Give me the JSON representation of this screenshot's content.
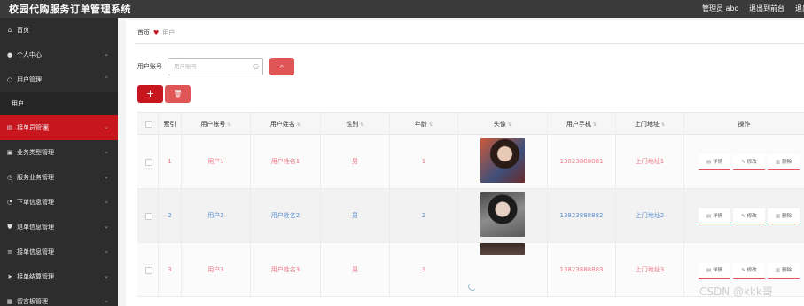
{
  "header": {
    "app_title": "校园代购服务订单管理系统",
    "user_label": "管理员 abo",
    "back_label": "退出到前台",
    "logout_label": "退出登录"
  },
  "sidebar": {
    "items": [
      {
        "label": "首页",
        "icon": "home-icon",
        "glyph": "⌂"
      },
      {
        "label": "个人中心",
        "icon": "person-icon",
        "glyph": "●"
      },
      {
        "label": "用户管理",
        "icon": "user-circle-icon",
        "glyph": "○"
      },
      {
        "label": "接单员管理",
        "icon": "document-icon",
        "glyph": "▤"
      },
      {
        "label": "业务类型管理",
        "icon": "clipboard-icon",
        "glyph": "▣"
      },
      {
        "label": "服务业务管理",
        "icon": "clock-icon",
        "glyph": "◷"
      },
      {
        "label": "下单信息管理",
        "icon": "circle-info-icon",
        "glyph": "◔"
      },
      {
        "label": "退单信息管理",
        "icon": "shield-icon",
        "glyph": "⛊"
      },
      {
        "label": "接单信息管理",
        "icon": "list-icon",
        "glyph": "≡"
      },
      {
        "label": "接单结算管理",
        "icon": "send-icon",
        "glyph": "➤"
      },
      {
        "label": "留言板管理",
        "icon": "grid-icon",
        "glyph": "▦"
      }
    ],
    "sub_item": "用户"
  },
  "breadcrumb": {
    "home": "首页",
    "current": "用户"
  },
  "search": {
    "label": "用户账号",
    "placeholder": "用户账号",
    "button_icon": "search-icon"
  },
  "actions": {
    "add_symbol": "+",
    "delete_symbol": "🗑"
  },
  "table": {
    "headers": [
      "索引",
      "用户账号",
      "用户姓名",
      "性别",
      "年龄",
      "头像",
      "用户手机",
      "上门地址",
      "操作"
    ],
    "rows": [
      {
        "index": "1",
        "account": "用户1",
        "name": "用户姓名1",
        "gender": "男",
        "age": "1",
        "phone": "13823888881",
        "address": "上门地址1",
        "color": "pink"
      },
      {
        "index": "2",
        "account": "用户2",
        "name": "用户姓名2",
        "gender": "男",
        "age": "2",
        "phone": "13823888882",
        "address": "上门地址2",
        "color": "blue"
      },
      {
        "index": "3",
        "account": "用户3",
        "name": "用户姓名3",
        "gender": "男",
        "age": "3",
        "phone": "13823888883",
        "address": "上门地址3",
        "color": "pink"
      }
    ],
    "op_labels": {
      "detail": "详情",
      "edit": "修改",
      "delete": "删除"
    }
  },
  "watermark": "CSDN @kkk哥",
  "colors": {
    "accent": "#c8161e",
    "accent_light": "#e05555",
    "sidebar_bg": "#2d2d2d",
    "topbar_bg": "#3a3a3a"
  }
}
